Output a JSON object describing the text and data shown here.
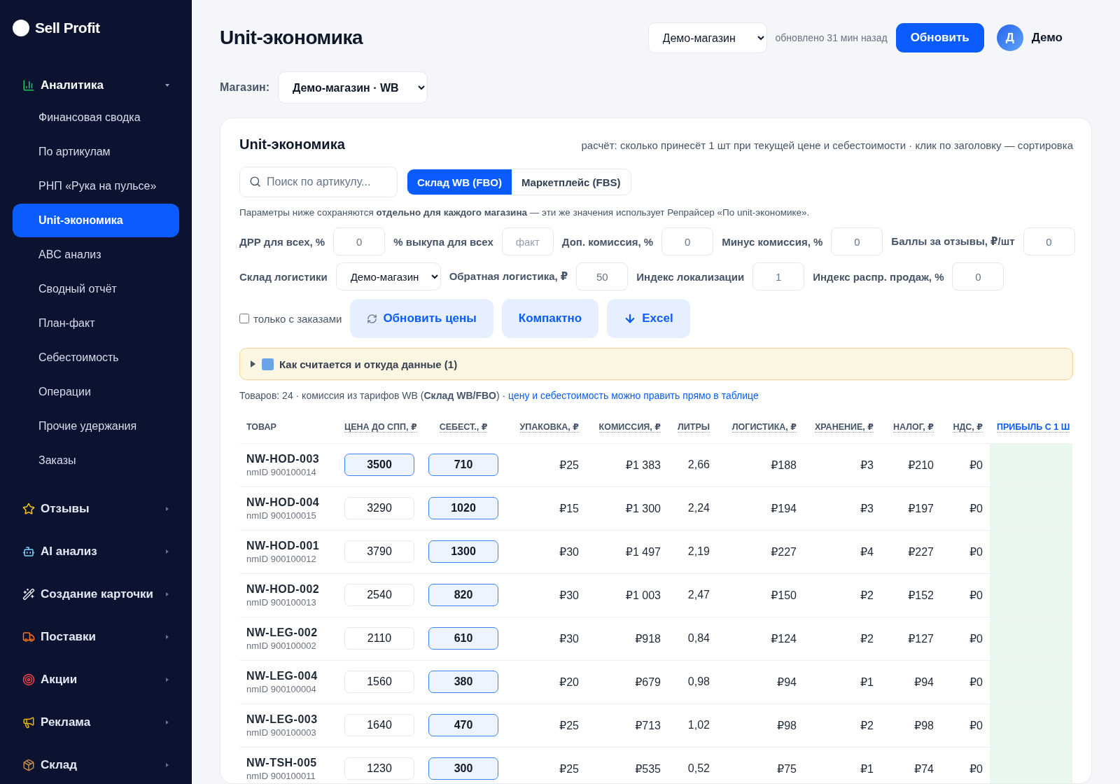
{
  "sidebar": {
    "logo": "Sell Profit",
    "groups": [
      {
        "label": "Аналитика",
        "expanded": true,
        "items": [
          {
            "label": "Финансовая сводка",
            "selected": false
          },
          {
            "label": "По артикулам",
            "selected": false
          },
          {
            "label": "РНП «Рука на пульсе»",
            "selected": false
          },
          {
            "label": "Unit-экономика",
            "selected": true
          },
          {
            "label": "ABC анализ",
            "selected": false
          },
          {
            "label": "Сводный отчёт",
            "selected": false
          },
          {
            "label": "План-факт",
            "selected": false
          },
          {
            "label": "Себестоимость",
            "selected": false
          },
          {
            "label": "Операции",
            "selected": false
          },
          {
            "label": "Прочие удержания",
            "selected": false
          },
          {
            "label": "Заказы",
            "selected": false
          }
        ]
      },
      {
        "label": "Отзывы",
        "expanded": false
      },
      {
        "label": "AI анализ",
        "expanded": false
      },
      {
        "label": "Создание карточки",
        "expanded": false
      },
      {
        "label": "Поставки",
        "expanded": false
      },
      {
        "label": "Акции",
        "expanded": false
      },
      {
        "label": "Реклама",
        "expanded": false
      },
      {
        "label": "Склад",
        "expanded": false
      }
    ]
  },
  "header": {
    "title": "Unit-экономика",
    "store": "Демо-магазин",
    "updated": "обновлено 31 мин назад",
    "refresh": "Обновить",
    "avatar": "Д",
    "user": "Демо"
  },
  "store_filter": {
    "label": "Магазин:",
    "value": "Демо-магазин · WB"
  },
  "card": {
    "title": "Unit-экономика",
    "hint": "расчёт: сколько принесёт 1 шт при текущей цене и себестоимости · клик по заголовку — сортировка",
    "search": {
      "placeholder": "Поиск по артикулу..."
    },
    "tabs": [
      {
        "label": "Склад WB (FBO)",
        "selected": true
      },
      {
        "label": "Маркетплейс (FBS)",
        "selected": false
      }
    ],
    "note": "Параметры ниже сохраняются **отдельно для каждого магазина** — эти же значения использует Репрайсер «По unit-экономике».",
    "params_rows": [
      [
        {
          "kind": "input",
          "label": "ДРР для всех, %",
          "value": "0"
        },
        {
          "kind": "input",
          "label": "% выкупа для всех",
          "placeholder": "факт"
        },
        {
          "kind": "input",
          "label": "Доп. комиссия, %",
          "value": "0"
        },
        {
          "kind": "input",
          "label": "Минус комиссия, %",
          "value": "0"
        },
        {
          "kind": "input",
          "label": "Баллы за отзывы, ₽/шт",
          "value": "0"
        }
      ],
      [
        {
          "kind": "select",
          "label": "Склад логистики",
          "value": "Демо-магазин"
        },
        {
          "kind": "input",
          "label": "Обратная логистика, ₽",
          "value": "50"
        },
        {
          "kind": "input",
          "label": "Индекс локализации",
          "value": "1"
        },
        {
          "kind": "input",
          "label": "Индекс распр. продаж, %",
          "value": "0"
        }
      ]
    ],
    "only_orders": {
      "label": "только с заказами",
      "checked": false
    },
    "actions": [
      "Обновить цены",
      "Компактно",
      "Excel"
    ],
    "details": {
      "label": "Как считается и откуда данные (1)",
      "expanded": false
    },
    "summary": "Товаров: 24 · комиссия из тарифов WB (**Склад WB/FBO**) · ",
    "summary_link": "цену и себестоимость можно править прямо в таблице",
    "table": {
      "columns": [
        "ТОВАР",
        "ЦЕНА ДО СПП, ₽",
        "СЕБЕСТ., ₽",
        "УПАКОВКА, ₽",
        "КОМИССИЯ, ₽",
        "ЛИТРЫ",
        "ЛОГИСТИКА, ₽",
        "ХРАНЕНИЕ, ₽",
        "НАЛОГ, ₽",
        "НДС, ₽",
        "ПРИБЫЛЬ С 1 Ш"
      ],
      "rows": [
        {
          "cells": [
            {
              "kind": "product",
              "sku": "NW-HOD-003",
              "nmid": "nmID 900100014"
            },
            {
              "kind": "edit",
              "value": "3500",
              "edited": true
            },
            {
              "kind": "edit",
              "value": "710",
              "edited": true
            },
            "₽25",
            "₽1 383",
            "2,66",
            "₽188",
            "₽3",
            "₽210",
            "₽0",
            {
              "kind": "profit"
            }
          ]
        },
        {
          "cells": [
            {
              "kind": "product",
              "sku": "NW-HOD-004",
              "nmid": "nmID 900100015"
            },
            {
              "kind": "edit",
              "value": "3290",
              "edited": false
            },
            {
              "kind": "edit",
              "value": "1020",
              "edited": true
            },
            "₽15",
            "₽1 300",
            "2,24",
            "₽194",
            "₽3",
            "₽197",
            "₽0",
            {
              "kind": "profit"
            }
          ]
        },
        {
          "cells": [
            {
              "kind": "product",
              "sku": "NW-HOD-001",
              "nmid": "nmID 900100012"
            },
            {
              "kind": "edit",
              "value": "3790",
              "edited": false
            },
            {
              "kind": "edit",
              "value": "1300",
              "edited": true
            },
            "₽30",
            "₽1 497",
            "2,19",
            "₽227",
            "₽4",
            "₽227",
            "₽0",
            {
              "kind": "profit"
            }
          ]
        },
        {
          "cells": [
            {
              "kind": "product",
              "sku": "NW-HOD-002",
              "nmid": "nmID 900100013"
            },
            {
              "kind": "edit",
              "value": "2540",
              "edited": false
            },
            {
              "kind": "edit",
              "value": "820",
              "edited": true
            },
            "₽30",
            "₽1 003",
            "2,47",
            "₽150",
            "₽2",
            "₽152",
            "₽0",
            {
              "kind": "profit"
            }
          ]
        },
        {
          "cells": [
            {
              "kind": "product",
              "sku": "NW-LEG-002",
              "nmid": "nmID 900100002"
            },
            {
              "kind": "edit",
              "value": "2110",
              "edited": false
            },
            {
              "kind": "edit",
              "value": "610",
              "edited": true
            },
            "₽30",
            "₽918",
            "0,84",
            "₽124",
            "₽2",
            "₽127",
            "₽0",
            {
              "kind": "profit"
            }
          ]
        },
        {
          "cells": [
            {
              "kind": "product",
              "sku": "NW-LEG-004",
              "nmid": "nmID 900100004"
            },
            {
              "kind": "edit",
              "value": "1560",
              "edited": false
            },
            {
              "kind": "edit",
              "value": "380",
              "edited": true
            },
            "₽20",
            "₽679",
            "0,98",
            "₽94",
            "₽1",
            "₽94",
            "₽0",
            {
              "kind": "profit"
            }
          ]
        },
        {
          "cells": [
            {
              "kind": "product",
              "sku": "NW-LEG-003",
              "nmid": "nmID 900100003"
            },
            {
              "kind": "edit",
              "value": "1640",
              "edited": false
            },
            {
              "kind": "edit",
              "value": "470",
              "edited": true
            },
            "₽25",
            "₽713",
            "1,02",
            "₽98",
            "₽2",
            "₽98",
            "₽0",
            {
              "kind": "profit"
            }
          ]
        },
        {
          "cells": [
            {
              "kind": "product",
              "sku": "NW-TSH-005",
              "nmid": "nmID 900100011"
            },
            {
              "kind": "edit",
              "value": "1230",
              "edited": false
            },
            {
              "kind": "edit",
              "value": "300",
              "edited": true
            },
            "₽25",
            "₽535",
            "0,52",
            "₽75",
            "₽1",
            "₽74",
            "₽0",
            {
              "kind": "profit"
            }
          ]
        }
      ]
    }
  }
}
